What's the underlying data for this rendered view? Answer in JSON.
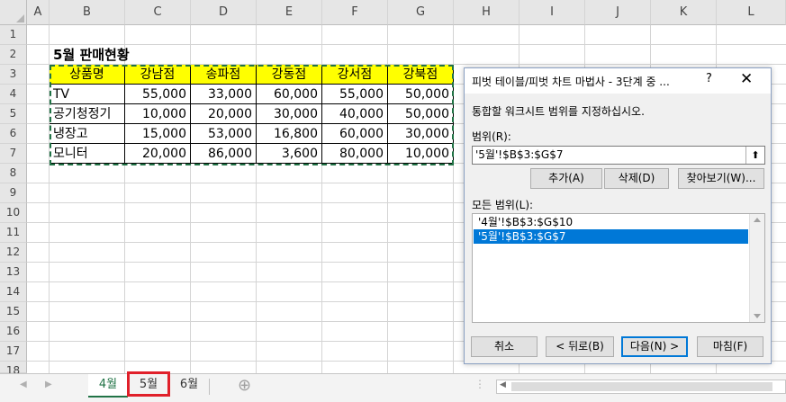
{
  "columns": [
    "A",
    "B",
    "C",
    "D",
    "E",
    "F",
    "G",
    "H",
    "I",
    "J",
    "K",
    "L"
  ],
  "rows": [
    "1",
    "2",
    "3",
    "4",
    "5",
    "6",
    "7",
    "8",
    "9",
    "10",
    "11",
    "12",
    "13",
    "14",
    "15",
    "16",
    "17",
    "18"
  ],
  "sheet": {
    "title": "5월 판매현황",
    "headers": [
      "상품명",
      "강남점",
      "송파점",
      "강동점",
      "강서점",
      "강북점"
    ],
    "data": [
      [
        "TV",
        "55,000",
        "33,000",
        "60,000",
        "55,000",
        "50,000"
      ],
      [
        "공기청정기",
        "10,000",
        "20,000",
        "30,000",
        "40,000",
        "50,000"
      ],
      [
        "냉장고",
        "15,000",
        "53,000",
        "16,800",
        "60,000",
        "30,000"
      ],
      [
        "모니터",
        "20,000",
        "86,000",
        "3,600",
        "80,000",
        "10,000"
      ]
    ]
  },
  "dialog": {
    "title": "피벗 테이블/피벗 차트 마법사 - 3단계 중 ...",
    "help": "?",
    "close": "✕",
    "instruction": "통합할 워크시트 범위를 지정하십시오.",
    "range_label": "범위(R):",
    "range_value": "'5월'!$B$3:$G$7",
    "collapse_icon": "⬆",
    "add_label": "추가(A)",
    "delete_label": "삭제(D)",
    "browse_label": "찾아보기(W)...",
    "all_ranges_label": "모든 범위(L):",
    "ranges": [
      "'4월'!$B$3:$G$10",
      "'5월'!$B$3:$G$7"
    ],
    "cancel_label": "취소",
    "back_label": "< 뒤로(B)",
    "next_label": "다음(N) >",
    "finish_label": "마침(F)"
  },
  "tabs": [
    "4월",
    "5월",
    "6월"
  ],
  "add_sheet": "⊕",
  "colors": {
    "accent": "#217346",
    "highlight": "#ffff00",
    "selection": "#0078d7",
    "tab_marker": "#e0202a"
  }
}
